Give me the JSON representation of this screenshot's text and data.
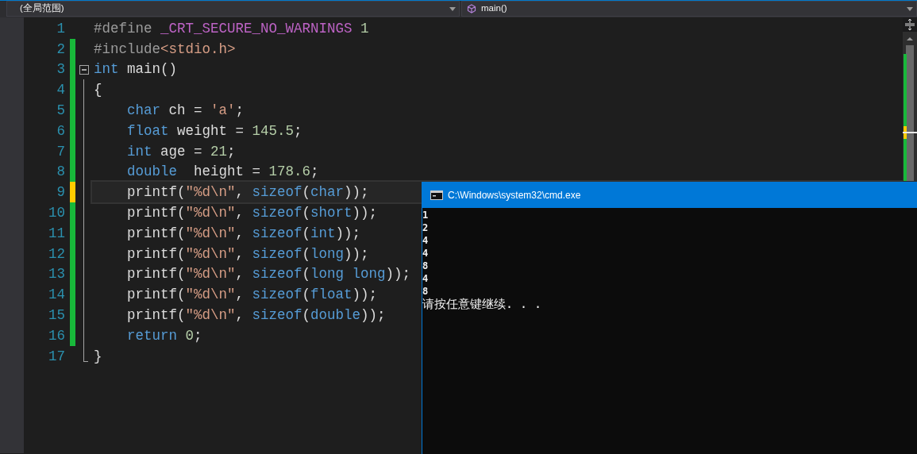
{
  "scope_bar": {
    "scope": "(全局范围)",
    "function": "main()"
  },
  "editor": {
    "lines": [
      {
        "number": "1",
        "current": false,
        "tokens": [
          {
            "text": "#define ",
            "kind": "pre"
          },
          {
            "text": "_CRT_SECURE_NO_WARNINGS ",
            "kind": "macro"
          },
          {
            "text": "1",
            "kind": "num"
          }
        ]
      },
      {
        "number": "2",
        "color": "#18b83a",
        "current": false,
        "tokens": [
          {
            "text": "#include",
            "kind": "pre"
          },
          {
            "text": "<stdio.h>",
            "kind": "str"
          }
        ]
      },
      {
        "number": "3",
        "color": "#18b83a",
        "current": false,
        "fold": {
          "expanded": true
        },
        "tokens": [
          {
            "text": "int",
            "kind": "kw"
          },
          {
            "text": " main()",
            "kind": "plain"
          }
        ]
      },
      {
        "number": "4",
        "color": "#18b83a",
        "current": false,
        "tokens": [
          {
            "text": "{",
            "kind": "plain"
          }
        ]
      },
      {
        "number": "5",
        "color": "#18b83a",
        "current": false,
        "indented": true,
        "tokens": [
          {
            "text": "char",
            "kind": "kw"
          },
          {
            "text": " ch = ",
            "kind": "plain"
          },
          {
            "text": "'a'",
            "kind": "str"
          },
          {
            "text": ";",
            "kind": "plain"
          }
        ]
      },
      {
        "number": "6",
        "color": "#18b83a",
        "current": false,
        "indented": true,
        "tokens": [
          {
            "text": "float",
            "kind": "kw"
          },
          {
            "text": " weight = ",
            "kind": "plain"
          },
          {
            "text": "145.5",
            "kind": "num"
          },
          {
            "text": ";",
            "kind": "plain"
          }
        ]
      },
      {
        "number": "7",
        "color": "#18b83a",
        "current": false,
        "indented": true,
        "tokens": [
          {
            "text": "int",
            "kind": "kw"
          },
          {
            "text": " age = ",
            "kind": "plain"
          },
          {
            "text": "21",
            "kind": "num"
          },
          {
            "text": ";",
            "kind": "plain"
          }
        ]
      },
      {
        "number": "8",
        "color": "#18b83a",
        "current": false,
        "indented": true,
        "tokens": [
          {
            "text": "double",
            "kind": "kw"
          },
          {
            "text": "  height = ",
            "kind": "plain"
          },
          {
            "text": "178.6",
            "kind": "num"
          },
          {
            "text": ";",
            "kind": "plain"
          }
        ]
      },
      {
        "number": "9",
        "color": "#ffcc00",
        "current": true,
        "indented": true,
        "tokens": [
          {
            "text": "printf(",
            "kind": "plain"
          },
          {
            "text": "\"%d\\n\"",
            "kind": "str"
          },
          {
            "text": ", ",
            "kind": "plain"
          },
          {
            "text": "sizeof",
            "kind": "kw"
          },
          {
            "text": "(",
            "kind": "plain"
          },
          {
            "text": "char",
            "kind": "kw"
          },
          {
            "text": "));",
            "kind": "plain"
          }
        ]
      },
      {
        "number": "10",
        "color": "#18b83a",
        "current": false,
        "indented": true,
        "tokens": [
          {
            "text": "printf(",
            "kind": "plain"
          },
          {
            "text": "\"%d\\n\"",
            "kind": "str"
          },
          {
            "text": ", ",
            "kind": "plain"
          },
          {
            "text": "sizeof",
            "kind": "kw"
          },
          {
            "text": "(",
            "kind": "plain"
          },
          {
            "text": "short",
            "kind": "kw"
          },
          {
            "text": "));",
            "kind": "plain"
          }
        ]
      },
      {
        "number": "11",
        "color": "#18b83a",
        "current": false,
        "indented": true,
        "tokens": [
          {
            "text": "printf(",
            "kind": "plain"
          },
          {
            "text": "\"%d\\n\"",
            "kind": "str"
          },
          {
            "text": ", ",
            "kind": "plain"
          },
          {
            "text": "sizeof",
            "kind": "kw"
          },
          {
            "text": "(",
            "kind": "plain"
          },
          {
            "text": "int",
            "kind": "kw"
          },
          {
            "text": "));",
            "kind": "plain"
          }
        ]
      },
      {
        "number": "12",
        "color": "#18b83a",
        "current": false,
        "indented": true,
        "tokens": [
          {
            "text": "printf(",
            "kind": "plain"
          },
          {
            "text": "\"%d\\n\"",
            "kind": "str"
          },
          {
            "text": ", ",
            "kind": "plain"
          },
          {
            "text": "sizeof",
            "kind": "kw"
          },
          {
            "text": "(",
            "kind": "plain"
          },
          {
            "text": "long",
            "kind": "kw"
          },
          {
            "text": "));",
            "kind": "plain"
          }
        ]
      },
      {
        "number": "13",
        "color": "#18b83a",
        "current": false,
        "indented": true,
        "tokens": [
          {
            "text": "printf(",
            "kind": "plain"
          },
          {
            "text": "\"%d\\n\"",
            "kind": "str"
          },
          {
            "text": ", ",
            "kind": "plain"
          },
          {
            "text": "sizeof",
            "kind": "kw"
          },
          {
            "text": "(",
            "kind": "plain"
          },
          {
            "text": "long long",
            "kind": "kw"
          },
          {
            "text": "));",
            "kind": "plain"
          }
        ]
      },
      {
        "number": "14",
        "color": "#18b83a",
        "current": false,
        "indented": true,
        "tokens": [
          {
            "text": "printf(",
            "kind": "plain"
          },
          {
            "text": "\"%d\\n\"",
            "kind": "str"
          },
          {
            "text": ", ",
            "kind": "plain"
          },
          {
            "text": "sizeof",
            "kind": "kw"
          },
          {
            "text": "(",
            "kind": "plain"
          },
          {
            "text": "float",
            "kind": "kw"
          },
          {
            "text": "));",
            "kind": "plain"
          }
        ]
      },
      {
        "number": "15",
        "color": "#18b83a",
        "current": false,
        "indented": true,
        "tokens": [
          {
            "text": "printf(",
            "kind": "plain"
          },
          {
            "text": "\"%d\\n\"",
            "kind": "str"
          },
          {
            "text": ", ",
            "kind": "plain"
          },
          {
            "text": "sizeof",
            "kind": "kw"
          },
          {
            "text": "(",
            "kind": "plain"
          },
          {
            "text": "double",
            "kind": "kw"
          },
          {
            "text": "));",
            "kind": "plain"
          }
        ]
      },
      {
        "number": "16",
        "color": "#18b83a",
        "current": false,
        "indented": true,
        "tokens": [
          {
            "text": "return ",
            "kind": "kw"
          },
          {
            "text": "0",
            "kind": "num"
          },
          {
            "text": ";",
            "kind": "plain"
          }
        ]
      },
      {
        "number": "17",
        "current": false,
        "tokens": [
          {
            "text": "}",
            "kind": "plain"
          }
        ]
      }
    ]
  },
  "console": {
    "title": "C:\\Windows\\system32\\cmd.exe",
    "output": [
      "1",
      "2",
      "4",
      "4",
      "8",
      "4",
      "8",
      "请按任意键继续. . ."
    ]
  }
}
